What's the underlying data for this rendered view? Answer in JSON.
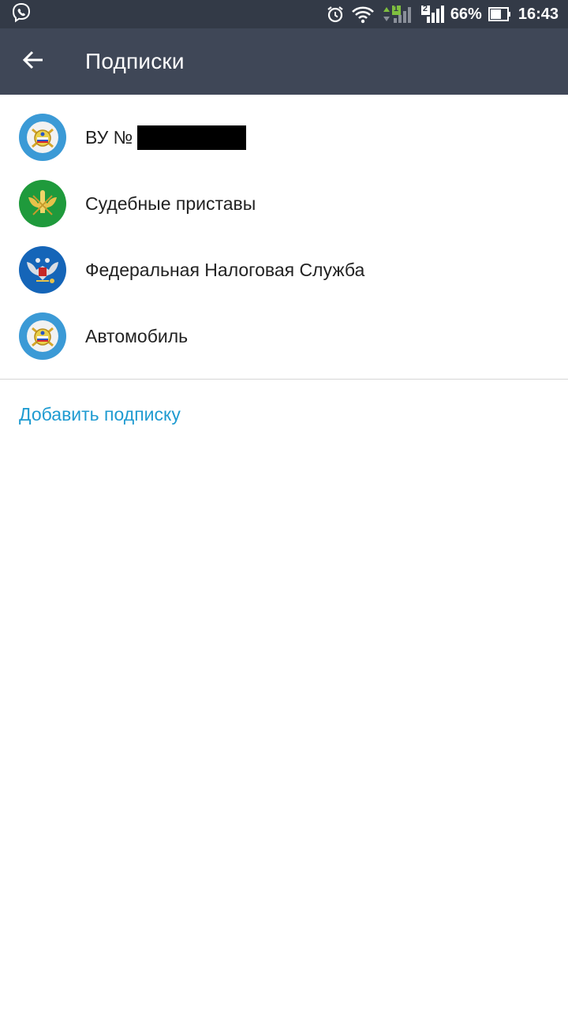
{
  "status_bar": {
    "battery": "66%",
    "time": "16:43",
    "sim_slot_1": "1",
    "sim_slot_2": "2",
    "icons": [
      "viber-icon",
      "alarm-icon",
      "wifi-icon",
      "signal-sim1-icon",
      "signal-sim2-icon",
      "battery-icon"
    ]
  },
  "toolbar": {
    "title": "Подписки",
    "back_icon": "arrow-left-icon"
  },
  "subscriptions": [
    {
      "label": "ВУ №",
      "emblem": "gibdd-emblem-icon",
      "redacted": true
    },
    {
      "label": "Судебные приставы",
      "emblem": "fssp-emblem-icon"
    },
    {
      "label": "Федеральная Налоговая Служба",
      "emblem": "fns-emblem-icon"
    },
    {
      "label": "Автомобиль",
      "emblem": "gibdd-emblem-icon"
    }
  ],
  "add_subscription_label": "Добавить подписку",
  "colors": {
    "status_bar_bg": "#333a47",
    "toolbar_bg": "#3f4757",
    "link": "#1f9bd1",
    "gibdd_blue": "#3b9ad6",
    "fssp_green": "#1f9a3c",
    "fns_blue": "#1565b8"
  }
}
